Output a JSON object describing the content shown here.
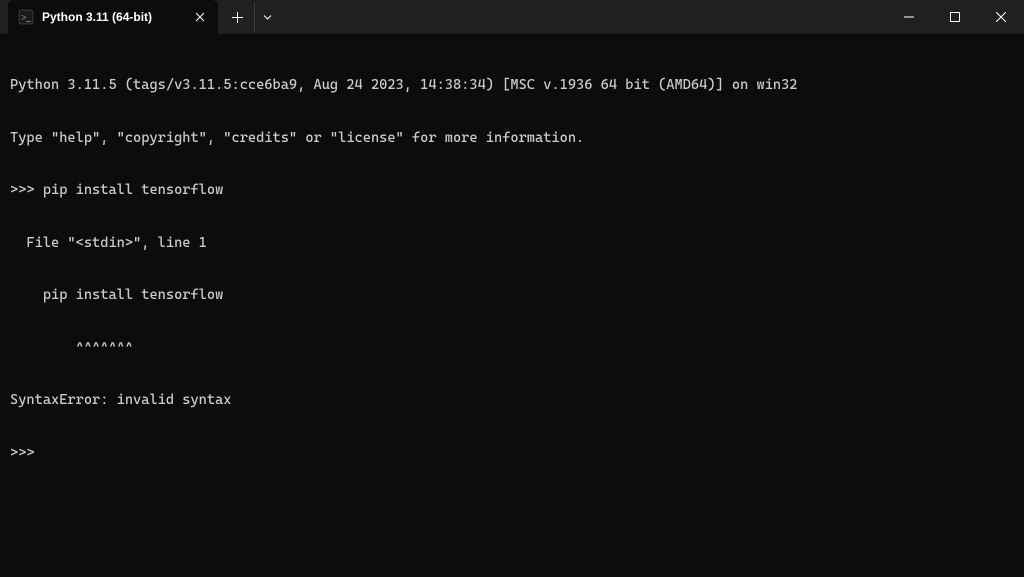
{
  "tab": {
    "title": "Python 3.11 (64-bit)"
  },
  "terminal": {
    "lines": [
      "Python 3.11.5 (tags/v3.11.5:cce6ba9, Aug 24 2023, 14:38:34) [MSC v.1936 64 bit (AMD64)] on win32",
      "Type \"help\", \"copyright\", \"credits\" or \"license\" for more information.",
      ">>> pip install tensorflow",
      "  File \"<stdin>\", line 1",
      "    pip install tensorflow",
      "        ^^^^^^^",
      "SyntaxError: invalid syntax",
      ">>> "
    ]
  }
}
